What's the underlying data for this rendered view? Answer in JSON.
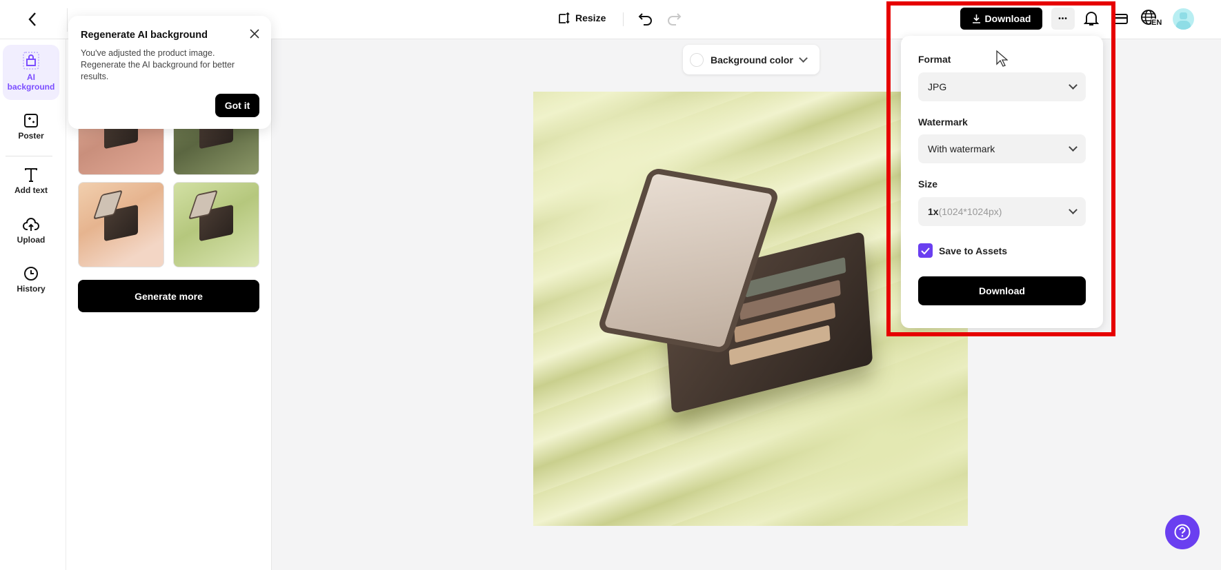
{
  "header": {
    "resize_label": "Resize",
    "download_label": "Download",
    "language": "EN",
    "more_label": "•••"
  },
  "sidebar": {
    "items": [
      {
        "label": "AI background"
      },
      {
        "label": "Poster"
      },
      {
        "label": "Add text"
      },
      {
        "label": "Upload"
      },
      {
        "label": "History"
      }
    ]
  },
  "panel": {
    "generate_more_label": "Generate more"
  },
  "tooltip": {
    "title": "Regenerate AI background",
    "body": "You've adjusted the product image. Regenerate the AI background for better results.",
    "button": "Got it"
  },
  "canvas": {
    "background_color_label": "Background color"
  },
  "download_popup": {
    "format_label": "Format",
    "format_value": "JPG",
    "watermark_label": "Watermark",
    "watermark_value": "With watermark",
    "size_label": "Size",
    "size_value": "1x",
    "size_detail": "(1024*1024px)",
    "save_to_assets_label": "Save to Assets",
    "save_to_assets_checked": true,
    "download_button": "Download"
  },
  "colors": {
    "accent": "#6a3ff0",
    "highlight": "#e60000"
  }
}
